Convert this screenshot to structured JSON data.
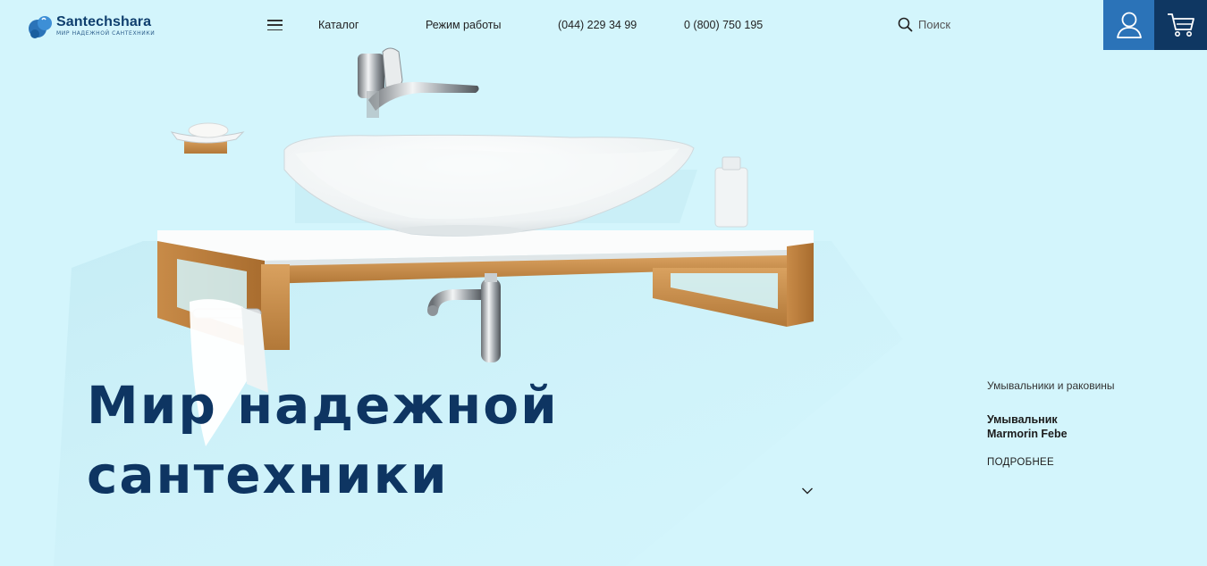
{
  "brand": {
    "name": "Santechshara",
    "tagline": "мир надежной сантехники",
    "colors": {
      "primary": "#0e3562",
      "accent": "#2b73b8",
      "background": "#d3f5fc"
    }
  },
  "header": {
    "menu_icon": "hamburger-menu-icon",
    "nav": {
      "catalog": "Каталог",
      "hours": "Режим работы",
      "phone_1": "(044) 229 34 99",
      "phone_2": "0 (800) 750 195"
    },
    "search": {
      "icon": "search-icon",
      "placeholder": "Поиск"
    },
    "account_icon": "user-icon",
    "cart_icon": "cart-icon"
  },
  "hero": {
    "title_line_1": "Мир надежной",
    "title_line_2": "сантехники",
    "scroll_icon": "chevron-down-icon"
  },
  "product": {
    "category": "Умывальники и раковины",
    "name_line_1": "Умывальник",
    "name_line_2": "Marmorin Febe",
    "more_label": "ПОДРОБНЕЕ"
  }
}
